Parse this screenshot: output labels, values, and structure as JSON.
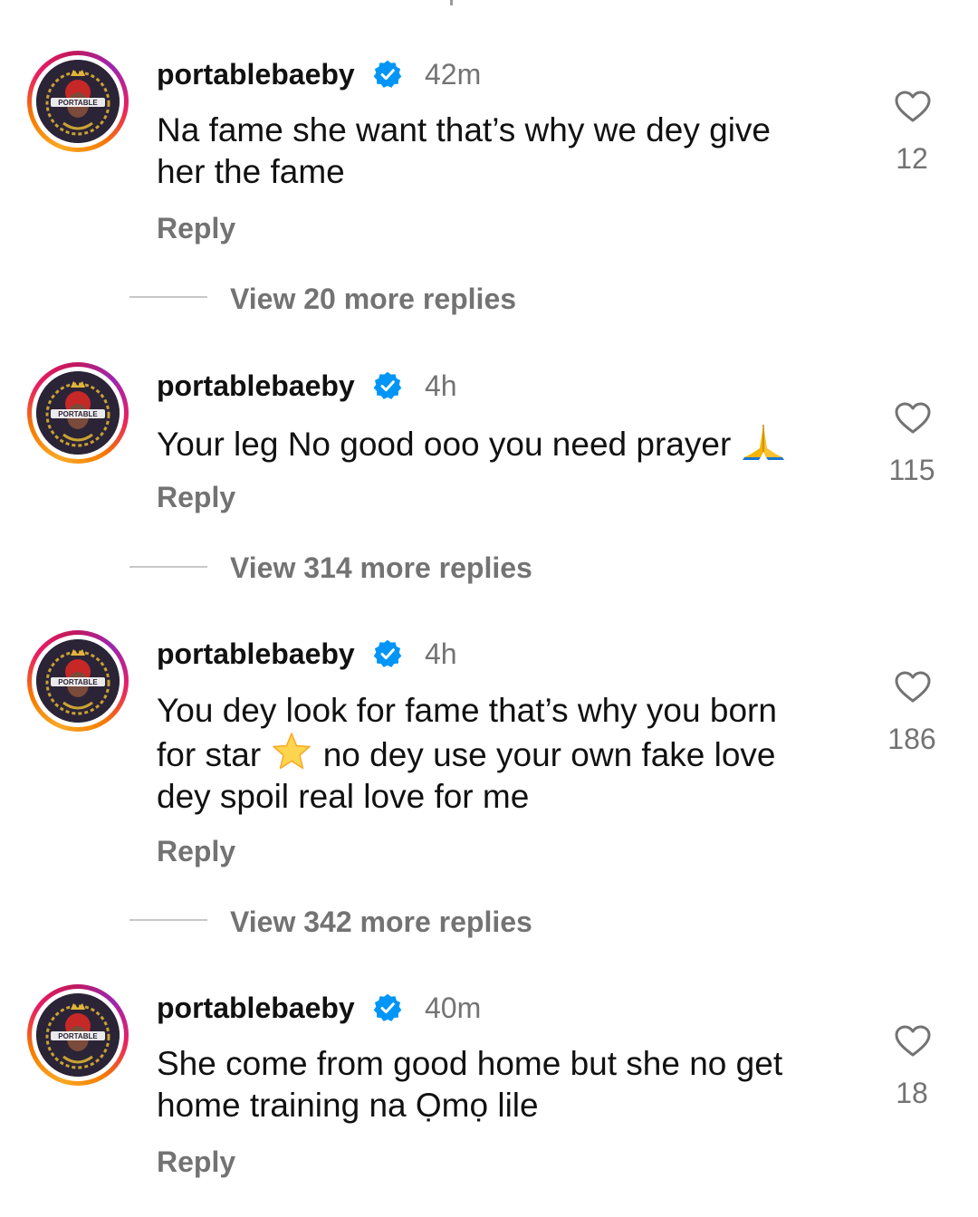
{
  "comments": [
    {
      "username": "portablebaeby",
      "time": "42m",
      "text_lines": [
        "Na fame she want that’s why we dey give",
        "her the fame"
      ],
      "likes": "12",
      "reply_label": "Reply",
      "view_more": "View 20 more replies"
    },
    {
      "username": "portablebaeby",
      "time": "4h",
      "text_lines": [
        "Your leg No good ooo you need prayer"
      ],
      "likes": "115",
      "reply_label": "Reply",
      "view_more": "View 314 more replies",
      "trailing_emoji": "folded-hands-icon"
    },
    {
      "username": "portablebaeby",
      "time": "4h",
      "text_lines": [
        "You dey look for fame that’s why you born",
        "for star",
        "no dey use your own fake love",
        "dey spoil real love for me"
      ],
      "likes": "186",
      "reply_label": "Reply",
      "view_more": "View 342 more replies",
      "inline_emoji": "star-icon"
    },
    {
      "username": "portablebaeby",
      "time": "40m",
      "text_lines": [
        "She come from good home but she no get",
        "home training na Ọmọ lile"
      ],
      "likes": "18",
      "reply_label": "Reply"
    }
  ],
  "avatar_label": "PORTABLE",
  "colors": {
    "text": "#111111",
    "muted": "#737373",
    "verified": "#0095f6",
    "divider": "#c7c7c7"
  }
}
